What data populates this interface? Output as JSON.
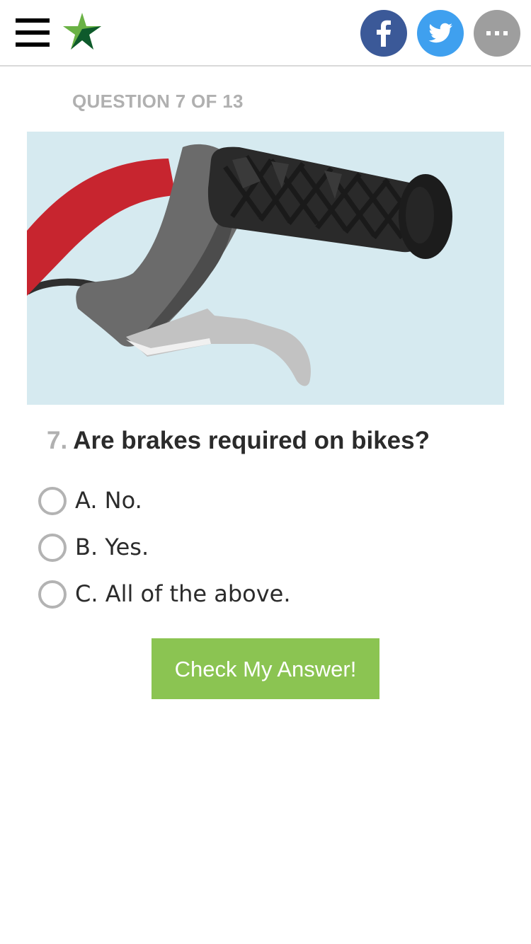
{
  "header": {
    "menu_icon": "hamburger-menu-icon",
    "logo_icon": "star-logo-icon",
    "brand_colors": {
      "star_light": "#6ab245",
      "star_dark": "#0e5a2c"
    },
    "share": [
      {
        "network": "facebook",
        "icon": "facebook-icon",
        "color": "#3b5998"
      },
      {
        "network": "twitter",
        "icon": "twitter-icon",
        "color": "#3fa0ef"
      },
      {
        "network": "more",
        "icon": "more-dots-icon",
        "color": "#9e9e9e"
      }
    ]
  },
  "quiz": {
    "progress_label": "QUESTION 7 OF 13",
    "current": 7,
    "total": 13,
    "image": "bike-brake-lever-illustration",
    "question_number": "7.",
    "question_text": "Are brakes required on bikes?",
    "options": [
      {
        "label": "A. No.",
        "selected": false
      },
      {
        "label": "B. Yes.",
        "selected": false
      },
      {
        "label": "C. All of the above.",
        "selected": false
      }
    ],
    "submit_label": "Check My Answer!",
    "submit_color": "#8bc452"
  }
}
